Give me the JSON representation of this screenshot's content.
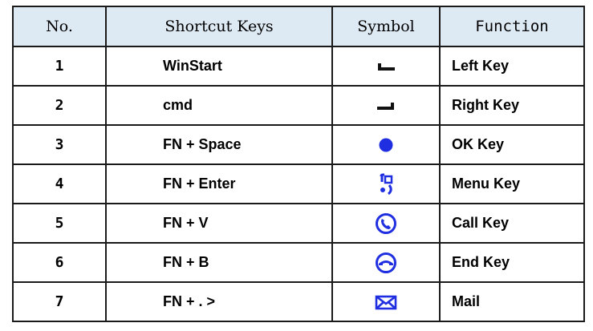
{
  "header": {
    "no": "No.",
    "keys": "Shortcut Keys",
    "symbol": "Symbol",
    "function": "Function"
  },
  "rows": [
    {
      "no": "1",
      "keys": "WinStart",
      "icon": "left-softkey-icon",
      "function": "Left Key"
    },
    {
      "no": "2",
      "keys": "cmd",
      "icon": "right-softkey-icon",
      "function": "Right Key"
    },
    {
      "no": "3",
      "keys": "FN + Space",
      "icon": "ok-dot-icon",
      "function": "OK Key"
    },
    {
      "no": "4",
      "keys": "FN + Enter",
      "icon": "menu-icon",
      "function": "Menu Key"
    },
    {
      "no": "5",
      "keys": "FN + V",
      "icon": "call-icon",
      "function": "Call Key"
    },
    {
      "no": "6",
      "keys": "FN + B",
      "icon": "end-call-icon",
      "function": "End Key"
    },
    {
      "no": "7",
      "keys": "FN + . >",
      "icon": "mail-icon",
      "function": "Mail"
    }
  ],
  "colors": {
    "header_bg": "#dde9f3",
    "icon_blue": "#1f2ee0",
    "softkey_black": "#111111"
  }
}
